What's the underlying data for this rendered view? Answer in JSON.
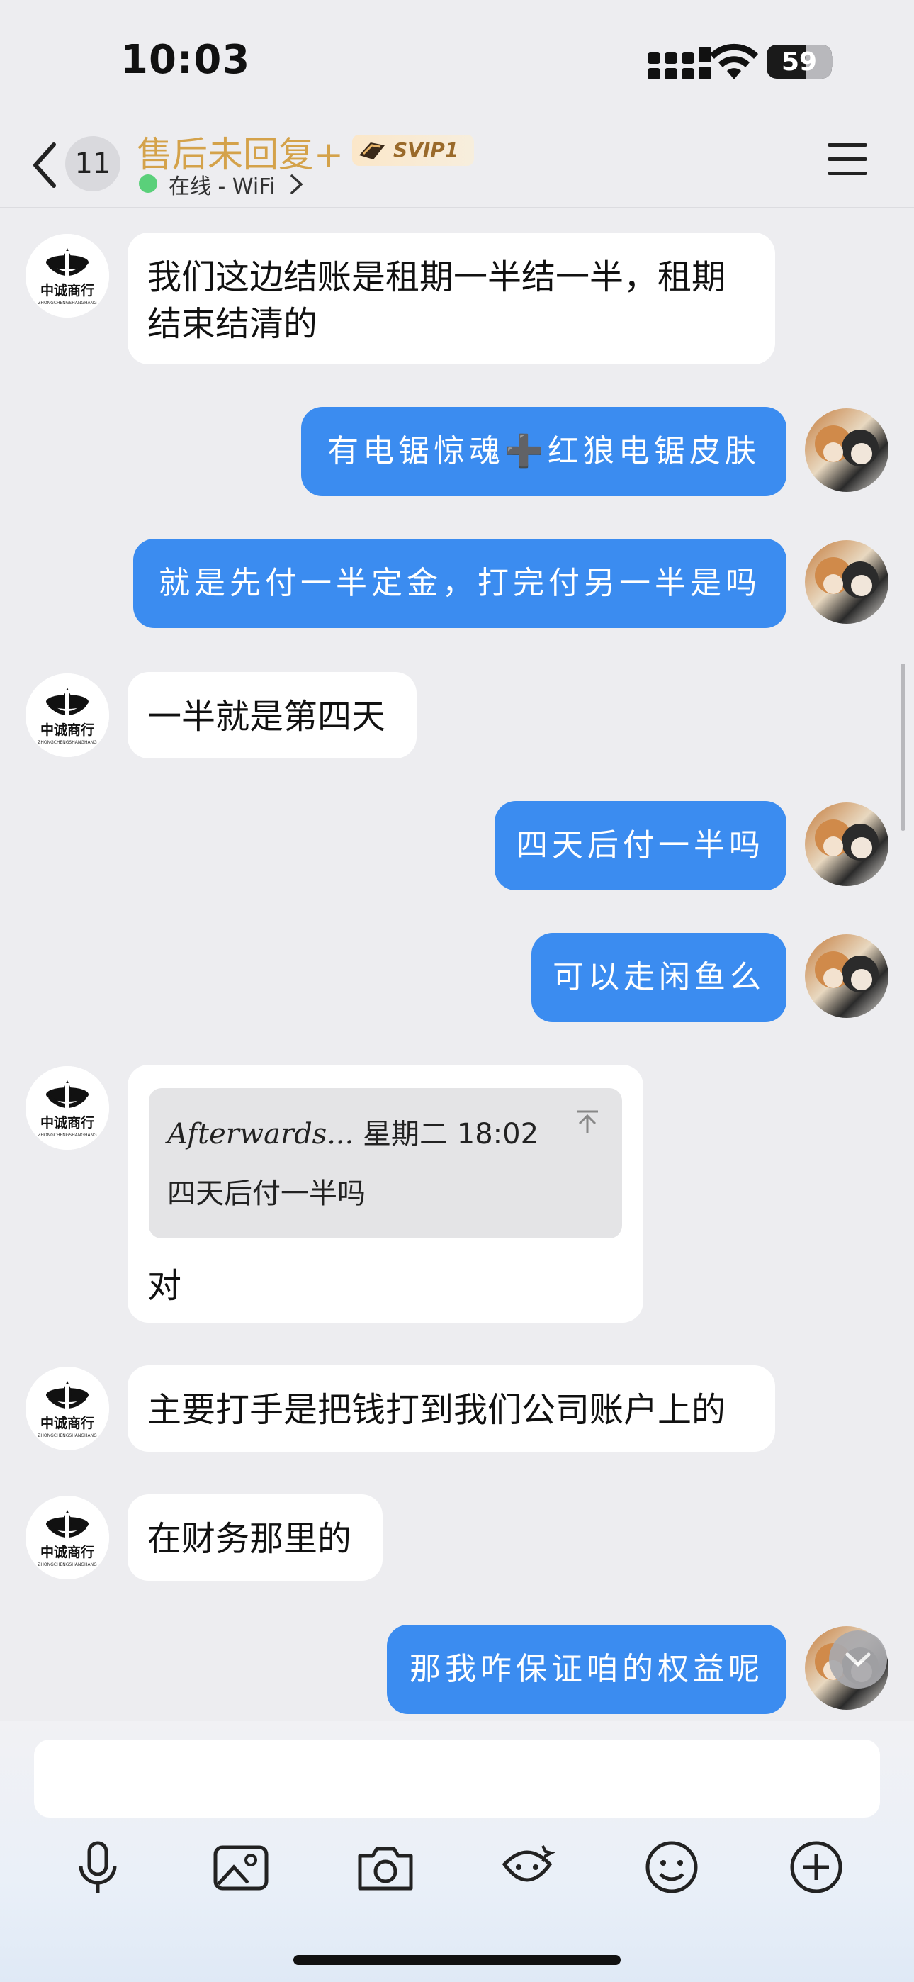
{
  "status_bar": {
    "time": "10:03",
    "battery": "59"
  },
  "nav": {
    "unread_count": "11",
    "title": "售后未回复+",
    "badge": "SVIP1",
    "presence": "在线 - WiFi"
  },
  "messages": [
    {
      "side": "in",
      "text": "我们这边结账是租期一半结一半，租期结束结清的"
    },
    {
      "side": "out",
      "text": "有电锯惊魂➕红狼电锯皮肤"
    },
    {
      "side": "out",
      "text": "就是先付一半定金，打完付另一半是吗"
    },
    {
      "side": "in",
      "text": "一半就是第四天"
    },
    {
      "side": "out",
      "text": "四天后付一半吗"
    },
    {
      "side": "out",
      "text": "可以走闲鱼么"
    },
    {
      "side": "in",
      "quote": {
        "author": "Afterwards...",
        "time": "星期二 18:02",
        "text": "四天后付一半吗"
      },
      "text": "对"
    },
    {
      "side": "in",
      "text": "主要打手是把钱打到我们公司账户上的"
    },
    {
      "side": "in",
      "text": "在财务那里的"
    },
    {
      "side": "out",
      "text": "那我咋保证咱的权益呢"
    }
  ],
  "avatars": {
    "contact_logo_text": "中诚商行",
    "contact_logo_sub": "ZHONGCHENGSHANGHANG"
  },
  "input": {
    "placeholder": ""
  },
  "toolbar": [
    "microphone-icon",
    "image-icon",
    "camera-icon",
    "sticker-icon",
    "emoji-icon",
    "plus-icon"
  ],
  "colors": {
    "outgoing_bubble": "#3b8cf0",
    "incoming_bubble": "#ffffff",
    "title": "#d4a24a",
    "online": "#5ad07a"
  }
}
